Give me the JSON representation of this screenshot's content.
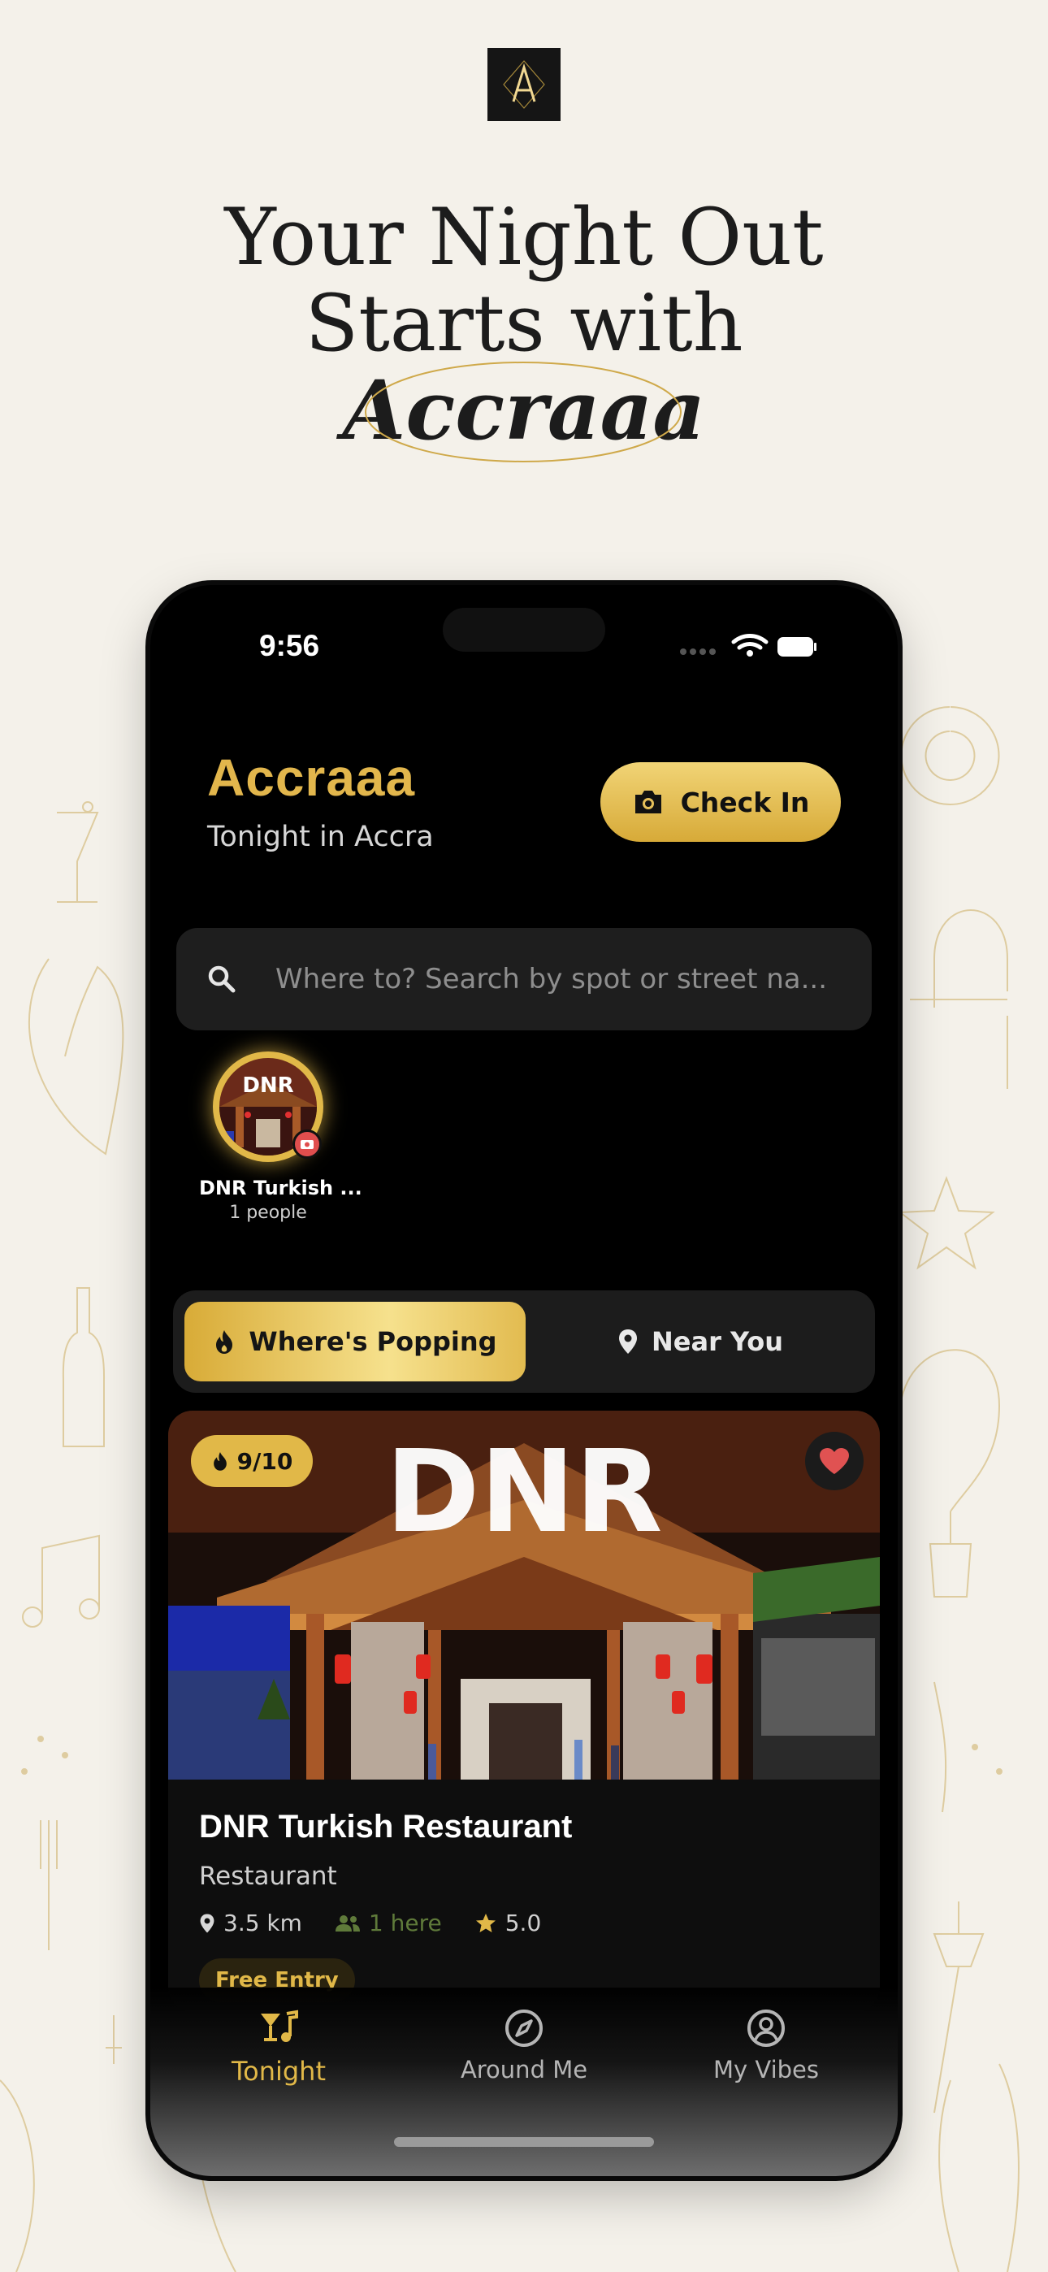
{
  "hero": {
    "line1": "Your Night Out",
    "line2": "Starts with",
    "brand": "Accraaa"
  },
  "status_bar": {
    "time": "9:56"
  },
  "app": {
    "title": "Accraaa",
    "subtitle": "Tonight in Accra",
    "check_in_label": "Check In"
  },
  "search": {
    "placeholder": "Where to? Search by spot or street na..."
  },
  "stories": [
    {
      "name": "DNR Turkish ...",
      "count": "1 people"
    }
  ],
  "segments": {
    "active": "Where's Popping",
    "inactive": "Near You"
  },
  "venue": {
    "score": "9/10",
    "name": "DNR Turkish Restaurant",
    "category": "Restaurant",
    "distance": "3.5 km",
    "here": "1 here",
    "rating": "5.0",
    "tag": "Free Entry",
    "sign_text": "DNR",
    "favorited": true
  },
  "tabs": [
    {
      "label": "Tonight",
      "icon": "cocktail-music-icon",
      "active": true
    },
    {
      "label": "Around Me",
      "icon": "compass-icon",
      "active": false
    },
    {
      "label": "My Vibes",
      "icon": "profile-icon",
      "active": false
    }
  ],
  "colors": {
    "accent": "#e1b848",
    "background": "#f4f1ea",
    "phone": "#000000",
    "favorite": "#e05252"
  }
}
